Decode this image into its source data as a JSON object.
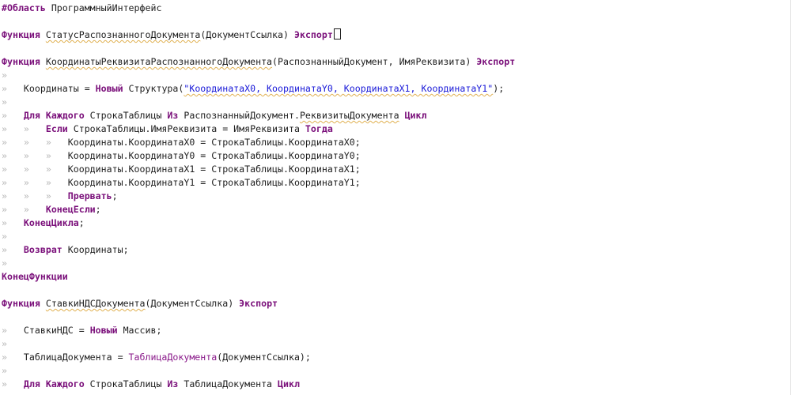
{
  "code_lines": [
    {
      "y": 0,
      "tokens": [
        {
          "t": "#Область",
          "c": "pre"
        },
        {
          "t": " ПрограммныйИнтерфейс",
          "c": "id"
        }
      ]
    },
    {
      "y": 1,
      "tokens": []
    },
    {
      "y": 2,
      "tokens": [
        {
          "t": "Функция",
          "c": "kw"
        },
        {
          "t": " ",
          "c": "id"
        },
        {
          "t": "СтатусРаспознанногоДокумента",
          "c": "id",
          "sq": true
        },
        {
          "t": "(ДокументСсылка) ",
          "c": "id"
        },
        {
          "t": "Экспорт",
          "c": "kw"
        },
        {
          "t": "",
          "c": "cursor"
        }
      ]
    },
    {
      "y": 3,
      "tokens": []
    },
    {
      "y": 4,
      "tokens": [
        {
          "t": "Функция",
          "c": "kw"
        },
        {
          "t": " ",
          "c": "id"
        },
        {
          "t": "КоординатыРеквизитаРаспознанногоДокумента",
          "c": "id",
          "sq": true
        },
        {
          "t": "(РаспознанныйДокумент, ИмяРеквизита) ",
          "c": "id"
        },
        {
          "t": "Экспорт",
          "c": "kw"
        }
      ]
    },
    {
      "y": 5,
      "tokens": [
        {
          "t": "»",
          "c": "g"
        }
      ]
    },
    {
      "y": 6,
      "tokens": [
        {
          "t": "»   ",
          "c": "g"
        },
        {
          "t": "Координаты = ",
          "c": "id"
        },
        {
          "t": "Новый",
          "c": "kw"
        },
        {
          "t": " Структура(",
          "c": "id"
        },
        {
          "t": "\"КоординатаX0, КоординатаY0, КоординатаX1, КоординатаY1\"",
          "c": "str"
        },
        {
          "t": ");",
          "c": "id"
        }
      ]
    },
    {
      "y": 7,
      "tokens": [
        {
          "t": "»",
          "c": "g"
        }
      ]
    },
    {
      "y": 8,
      "tokens": [
        {
          "t": "»   ",
          "c": "g"
        },
        {
          "t": "Для Каждого",
          "c": "kw"
        },
        {
          "t": " СтрокаТаблицы ",
          "c": "id"
        },
        {
          "t": "Из",
          "c": "kw"
        },
        {
          "t": " РаспознанныйДокумент.",
          "c": "id"
        },
        {
          "t": "РеквизитыДокумента",
          "c": "id",
          "sq": true
        },
        {
          "t": " ",
          "c": "id"
        },
        {
          "t": "Цикл",
          "c": "kw"
        }
      ]
    },
    {
      "y": 9,
      "tokens": [
        {
          "t": "»   »   ",
          "c": "g"
        },
        {
          "t": "Если",
          "c": "kw"
        },
        {
          "t": " СтрокаТаблицы.ИмяРеквизита = ИмяРеквизита ",
          "c": "id"
        },
        {
          "t": "Тогда",
          "c": "kw"
        }
      ]
    },
    {
      "y": 10,
      "tokens": [
        {
          "t": "»   »   »   ",
          "c": "g"
        },
        {
          "t": "Координаты.КоординатаX0 = СтрокаТаблицы.КоординатаX0;",
          "c": "id"
        }
      ]
    },
    {
      "y": 11,
      "tokens": [
        {
          "t": "»   »   »   ",
          "c": "g"
        },
        {
          "t": "Координаты.КоординатаY0 = СтрокаТаблицы.КоординатаY0;",
          "c": "id"
        }
      ]
    },
    {
      "y": 12,
      "tokens": [
        {
          "t": "»   »   »   ",
          "c": "g"
        },
        {
          "t": "Координаты.КоординатаX1 = СтрокаТаблицы.КоординатаX1;",
          "c": "id"
        }
      ]
    },
    {
      "y": 13,
      "tokens": [
        {
          "t": "»   »   »   ",
          "c": "g"
        },
        {
          "t": "Координаты.КоординатаY1 = СтрокаТаблицы.КоординатаY1;",
          "c": "id"
        }
      ]
    },
    {
      "y": 14,
      "tokens": [
        {
          "t": "»   »   »   ",
          "c": "g"
        },
        {
          "t": "Прервать",
          "c": "kw"
        },
        {
          "t": ";",
          "c": "id"
        }
      ]
    },
    {
      "y": 15,
      "tokens": [
        {
          "t": "»   »   ",
          "c": "g"
        },
        {
          "t": "КонецЕсли",
          "c": "kw"
        },
        {
          "t": ";",
          "c": "id"
        }
      ]
    },
    {
      "y": 16,
      "tokens": [
        {
          "t": "»   ",
          "c": "g"
        },
        {
          "t": "КонецЦикла",
          "c": "kw"
        },
        {
          "t": ";",
          "c": "id"
        }
      ]
    },
    {
      "y": 17,
      "tokens": [
        {
          "t": "»",
          "c": "g"
        }
      ]
    },
    {
      "y": 18,
      "tokens": [
        {
          "t": "»   ",
          "c": "g"
        },
        {
          "t": "Возврат",
          "c": "kw"
        },
        {
          "t": " Координаты;",
          "c": "id"
        }
      ]
    },
    {
      "y": 19,
      "tokens": [
        {
          "t": "»",
          "c": "g"
        }
      ]
    },
    {
      "y": 20,
      "tokens": [
        {
          "t": "КонецФункции",
          "c": "kw"
        }
      ]
    },
    {
      "y": 21,
      "tokens": []
    },
    {
      "y": 22,
      "tokens": [
        {
          "t": "Функция",
          "c": "kw"
        },
        {
          "t": " ",
          "c": "id"
        },
        {
          "t": "СтавкиНДСДокумента",
          "c": "id",
          "sq": true
        },
        {
          "t": "(ДокументСсылка) ",
          "c": "id"
        },
        {
          "t": "Экспорт",
          "c": "kw"
        }
      ]
    },
    {
      "y": 23,
      "tokens": []
    },
    {
      "y": 24,
      "tokens": [
        {
          "t": "»   ",
          "c": "g"
        },
        {
          "t": "СтавкиНДС = ",
          "c": "id"
        },
        {
          "t": "Новый",
          "c": "kw"
        },
        {
          "t": " Массив;",
          "c": "id"
        }
      ]
    },
    {
      "y": 25,
      "tokens": [
        {
          "t": "»",
          "c": "g"
        }
      ]
    },
    {
      "y": 26,
      "tokens": [
        {
          "t": "»   ",
          "c": "g"
        },
        {
          "t": "ТаблицаДокумента = ",
          "c": "id"
        },
        {
          "t": "ТаблицаДокумента",
          "c": "ref"
        },
        {
          "t": "(ДокументСсылка);",
          "c": "id"
        }
      ]
    },
    {
      "y": 27,
      "tokens": [
        {
          "t": "»",
          "c": "g"
        }
      ]
    },
    {
      "y": 28,
      "tokens": [
        {
          "t": "»   ",
          "c": "g"
        },
        {
          "t": "Для Каждого",
          "c": "kw"
        },
        {
          "t": " СтрокаТаблицы ",
          "c": "id"
        },
        {
          "t": "Из",
          "c": "kw"
        },
        {
          "t": " ТаблицаДокумента ",
          "c": "id"
        },
        {
          "t": "Цикл",
          "c": "kw"
        }
      ]
    }
  ]
}
